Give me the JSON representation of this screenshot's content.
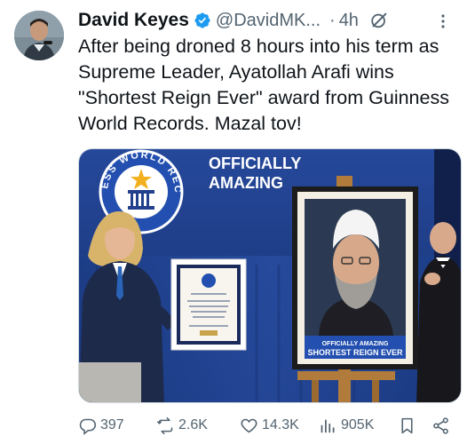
{
  "author": {
    "name": "David Keyes",
    "handle": "@DavidMK...",
    "time": "4h"
  },
  "tweet": {
    "text": "After being droned 8 hours into his term as Supreme Leader, Ayatollah Arafi wins \"Shortest Reign Ever\" award from Guinness World Records. Mazal tov!"
  },
  "media": {
    "backdrop_logo_text": "GUINNESS WORLD RECORDS",
    "backdrop_slogan_line1": "OFFICIALLY",
    "backdrop_slogan_line2": "AMAZING",
    "poster_caption_line1": "OFFICIALLY AMAZING",
    "poster_caption_line2": "SHORTEST REIGN EVER"
  },
  "actions": {
    "replies": "397",
    "reposts": "2.6K",
    "likes": "14.3K",
    "views": "905K"
  },
  "colors": {
    "verified": "#1d9bf0",
    "secondary_text": "#536471",
    "backdrop_blue": "#1f3f8c"
  }
}
